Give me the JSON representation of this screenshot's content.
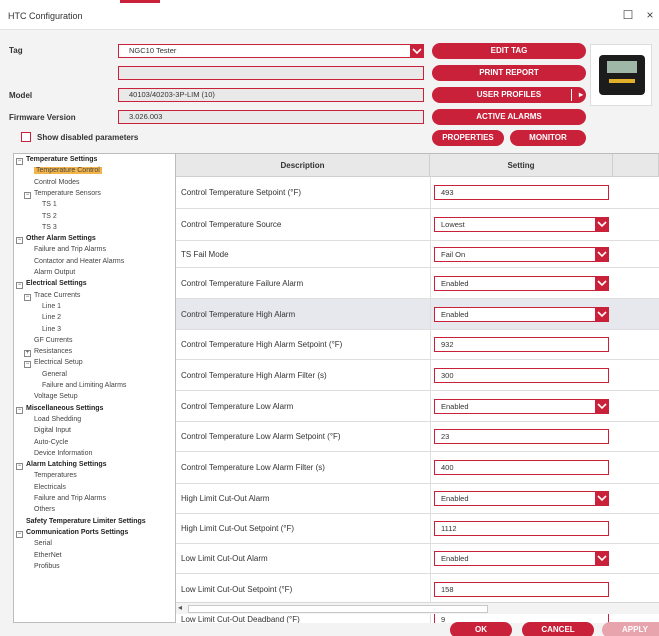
{
  "window": {
    "title": "HTC Configuration",
    "minimize_glyph": "☐",
    "close_glyph": "×"
  },
  "header": {
    "tag_label": "Tag",
    "tag_value": "NGC10 Tester",
    "blank_field": "",
    "model_label": "Model",
    "model_value": "40103/40203-3P-LIM (10)",
    "firmware_label": "Firmware Version",
    "firmware_value": "3.026.003",
    "show_disabled_label": "Show disabled parameters"
  },
  "buttons": {
    "edit_tag": "EDIT TAG",
    "print_report": "PRINT REPORT",
    "user_profiles": "USER PROFILES",
    "active_alarms": "ACTIVE ALARMS",
    "properties": "PROPERTIES",
    "monitor": "MONITOR",
    "ok": "OK",
    "cancel": "CANCEL",
    "apply": "APPLY"
  },
  "accent_color": "#c9213a",
  "tree": [
    {
      "label": "Temperature Settings",
      "bold": true,
      "toggle": "−"
    },
    {
      "label": "Temperature Control",
      "selected": true
    },
    {
      "label": "Control Modes"
    },
    {
      "label": "Temperature Sensors",
      "toggle": "−"
    },
    {
      "label": "TS 1"
    },
    {
      "label": "TS 2"
    },
    {
      "label": "TS 3"
    },
    {
      "label": "Other Alarm Settings",
      "bold": true,
      "toggle": "−"
    },
    {
      "label": "Failure and Trip Alarms"
    },
    {
      "label": "Contactor and Heater Alarms"
    },
    {
      "label": "Alarm Output"
    },
    {
      "label": "Electrical Settings",
      "bold": true,
      "toggle": "−"
    },
    {
      "label": "Trace Currents",
      "toggle": "−"
    },
    {
      "label": "Line 1"
    },
    {
      "label": "Line 2"
    },
    {
      "label": "Line 3"
    },
    {
      "label": "GF Currents"
    },
    {
      "label": "Resistances",
      "toggle": "+"
    },
    {
      "label": "Electrical Setup",
      "toggle": "−"
    },
    {
      "label": "General"
    },
    {
      "label": "Failure and Limiting Alarms"
    },
    {
      "label": "Voltage Setup"
    },
    {
      "label": "Miscellaneous Settings",
      "bold": true,
      "toggle": "−"
    },
    {
      "label": "Load Shedding"
    },
    {
      "label": "Digital Input"
    },
    {
      "label": "Auto-Cycle"
    },
    {
      "label": "Device Information"
    },
    {
      "label": "Alarm Latching Settings",
      "bold": true,
      "toggle": "−"
    },
    {
      "label": "Temperatures"
    },
    {
      "label": "Electricals"
    },
    {
      "label": "Failure and Trip Alarms"
    },
    {
      "label": "Others"
    },
    {
      "label": "Safety Temperature Limiter Settings",
      "bold": true
    },
    {
      "label": "Communication Ports Settings",
      "bold": true,
      "toggle": "−"
    },
    {
      "label": "Serial"
    },
    {
      "label": "EtherNet"
    },
    {
      "label": "Profibus"
    }
  ],
  "grid": {
    "col_description": "Description",
    "col_setting": "Setting",
    "rows": [
      {
        "description": "Control Temperature Setpoint (°F)",
        "value": "493",
        "dropdown": false
      },
      {
        "description": "Control Temperature Source",
        "value": "Lowest",
        "dropdown": true
      },
      {
        "description": "TS Fail Mode",
        "value": "Fail On",
        "dropdown": true
      },
      {
        "description": "Control Temperature Failure Alarm",
        "value": "Enabled",
        "dropdown": true
      },
      {
        "description": "Control Temperature High Alarm",
        "value": "Enabled",
        "dropdown": true,
        "highlighted": true
      },
      {
        "description": "Control Temperature High Alarm Setpoint (°F)",
        "value": "932",
        "dropdown": false
      },
      {
        "description": "Control Temperature High Alarm Filter (s)",
        "value": "300",
        "dropdown": false
      },
      {
        "description": "Control Temperature Low Alarm",
        "value": "Enabled",
        "dropdown": true
      },
      {
        "description": "Control Temperature Low Alarm Setpoint (°F)",
        "value": "23",
        "dropdown": false
      },
      {
        "description": "Control Temperature Low Alarm Filter (s)",
        "value": "400",
        "dropdown": false
      },
      {
        "description": "High Limit Cut-Out Alarm",
        "value": "Enabled",
        "dropdown": true
      },
      {
        "description": "High Limit Cut-Out Setpoint (°F)",
        "value": "1112",
        "dropdown": false
      },
      {
        "description": "Low Limit Cut-Out Alarm",
        "value": "Enabled",
        "dropdown": true
      },
      {
        "description": "Low Limit Cut-Out Setpoint (°F)",
        "value": "158",
        "dropdown": false
      },
      {
        "description": "Low Limit Cut-Out Deadband (°F)",
        "value": "9",
        "dropdown": false
      }
    ]
  }
}
